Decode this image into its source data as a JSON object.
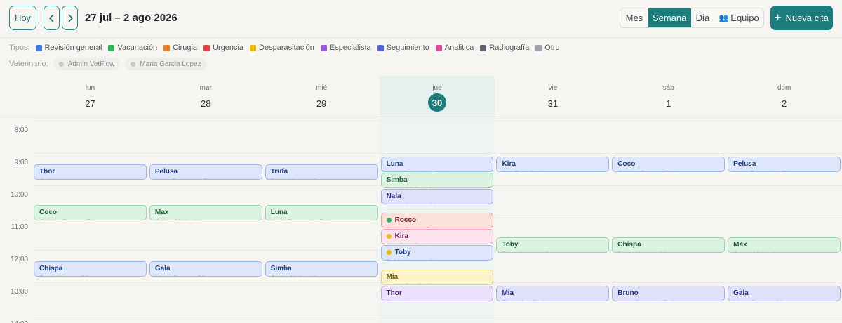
{
  "toolbar": {
    "today_label": "Hoy",
    "prev_icon": "‹",
    "next_icon": "›",
    "date_range": "27 jul – 2 ago 2026",
    "views": {
      "month": "Mes",
      "week": "Semana",
      "day": "Dia",
      "team": "Equipo"
    },
    "team_icon": "👥",
    "active_view": "Semana",
    "new_label": "Nueva cita",
    "new_icon": "+"
  },
  "types": {
    "label": "Tipos:",
    "items": [
      {
        "label": "Revisión general",
        "color": "#3d7be0"
      },
      {
        "label": "Vacunación",
        "color": "#34b45a"
      },
      {
        "label": "Cirugia",
        "color": "#ef7d22"
      },
      {
        "label": "Urgencia",
        "color": "#e04444"
      },
      {
        "label": "Desparasitación",
        "color": "#edb80f"
      },
      {
        "label": "Especialista",
        "color": "#9a55e0"
      },
      {
        "label": "Seguimiento",
        "color": "#5563e0"
      },
      {
        "label": "Analitica",
        "color": "#e0489a"
      },
      {
        "label": "Radiografía",
        "color": "#5d6470"
      },
      {
        "label": "Otro",
        "color": "#9aa3ad"
      }
    ]
  },
  "vets": {
    "label": "Veterinario:",
    "items": [
      "Admin VetFlow",
      "Maria Garcia Lopez"
    ]
  },
  "days": [
    {
      "name": "lun",
      "num": "27",
      "today": false
    },
    {
      "name": "mar",
      "num": "28",
      "today": false
    },
    {
      "name": "mié",
      "num": "29",
      "today": false
    },
    {
      "name": "jue",
      "num": "30",
      "today": true
    },
    {
      "name": "vie",
      "num": "31",
      "today": false
    },
    {
      "name": "sáb",
      "num": "1",
      "today": false
    },
    {
      "name": "dom",
      "num": "2",
      "today": false
    }
  ],
  "hours": [
    "8:00",
    "9:00",
    "10:00",
    "11:00",
    "12:00",
    "13:00",
    "14:00"
  ],
  "appointments": [
    {
      "day": 0,
      "start": "09:15",
      "end": "09:45",
      "pet": "Thor",
      "owner": "Carla Iriarte Larrea",
      "type": "revision"
    },
    {
      "day": 1,
      "start": "09:15",
      "end": "09:45",
      "pet": "Pelusa",
      "owner": "Lucia Fernandez Ruiz",
      "type": "revision"
    },
    {
      "day": 2,
      "start": "09:15",
      "end": "09:45",
      "pet": "Trufa",
      "owner": "Pablo Navarro Ortiz",
      "type": "revision"
    },
    {
      "day": 0,
      "start": "10:30",
      "end": "11:00",
      "pet": "Coco",
      "owner": "Cristina Romero Ruiz",
      "type": "vacunacion"
    },
    {
      "day": 1,
      "start": "10:30",
      "end": "11:00",
      "pet": "Max",
      "owner": "Carlos Molina Vera",
      "type": "vacunacion"
    },
    {
      "day": 2,
      "start": "10:30",
      "end": "11:00",
      "pet": "Luna",
      "owner": "Lucia Fernandez Ruiz",
      "type": "vacunacion"
    },
    {
      "day": 0,
      "start": "12:15",
      "end": "12:45",
      "pet": "Chispa",
      "owner": "Paula Herrera Gil",
      "type": "revision"
    },
    {
      "day": 1,
      "start": "12:15",
      "end": "12:45",
      "pet": "Gala",
      "owner": "Marta Serrano Gil",
      "type": "revision"
    },
    {
      "day": 2,
      "start": "12:15",
      "end": "12:45",
      "pet": "Simba",
      "owner": "Carlos Molina Vera",
      "type": "revision"
    },
    {
      "day": 3,
      "start": "09:00",
      "end": "09:30",
      "pet": "Luna",
      "owner": "Lucia Fernandez Ruiz",
      "type": "revision"
    },
    {
      "day": 3,
      "start": "09:30",
      "end": "10:00",
      "pet": "Simba",
      "owner": "Carlos Molina Vera",
      "type": "vacunacion"
    },
    {
      "day": 3,
      "start": "10:00",
      "end": "10:30",
      "pet": "Nala",
      "owner": "Marta Serrano Gil",
      "type": "seguimiento"
    },
    {
      "day": 3,
      "start": "10:45",
      "end": "11:15",
      "pet": "Rocco",
      "owner": "Javier Ortega Ruiz",
      "type": "urgencia",
      "status": "#34b45a"
    },
    {
      "day": 3,
      "start": "11:15",
      "end": "11:45",
      "pet": "Kira",
      "owner": "Ana Ruiz Garcia",
      "type": "analitica",
      "status": "#edb80f"
    },
    {
      "day": 3,
      "start": "11:45",
      "end": "12:15",
      "pet": "Toby",
      "owner": "Pablo Navarro Ortiz",
      "type": "revision",
      "status": "#edb80f"
    },
    {
      "day": 3,
      "start": "12:30",
      "end": "13:00",
      "pet": "Mia",
      "owner": "Elena Castillo Mora",
      "type": "desparasitacion"
    },
    {
      "day": 3,
      "start": "13:00",
      "end": "13:30",
      "pet": "Thor",
      "owner": "Carla Iriarte Larrea",
      "type": "especialista"
    },
    {
      "day": 4,
      "start": "09:00",
      "end": "09:30",
      "pet": "Kira",
      "owner": "Ana Ruiz Garcia",
      "type": "revision"
    },
    {
      "day": 5,
      "start": "09:00",
      "end": "09:30",
      "pet": "Coco",
      "owner": "Cristina Romero Ruiz",
      "type": "revision"
    },
    {
      "day": 6,
      "start": "09:00",
      "end": "09:30",
      "pet": "Pelusa",
      "owner": "Lucia Fernandez Ruiz",
      "type": "revision"
    },
    {
      "day": 4,
      "start": "11:30",
      "end": "12:00",
      "pet": "Toby",
      "owner": "Pablo Navarro Ortiz",
      "type": "vacunacion"
    },
    {
      "day": 5,
      "start": "11:30",
      "end": "12:00",
      "pet": "Chispa",
      "owner": "Paula Herrera Gil",
      "type": "vacunacion"
    },
    {
      "day": 6,
      "start": "11:30",
      "end": "12:00",
      "pet": "Max",
      "owner": "Carlos Molina Vera",
      "type": "vacunacion"
    },
    {
      "day": 4,
      "start": "13:00",
      "end": "13:30",
      "pet": "Mia",
      "owner": "Elena Castillo Mora",
      "type": "seguimiento"
    },
    {
      "day": 5,
      "start": "13:00",
      "end": "13:30",
      "pet": "Bruno",
      "owner": "Nuria Gonzalez Peña",
      "type": "seguimiento"
    },
    {
      "day": 6,
      "start": "13:00",
      "end": "13:30",
      "pet": "Gala",
      "owner": "Marta Serrano Gil",
      "type": "seguimiento"
    }
  ]
}
